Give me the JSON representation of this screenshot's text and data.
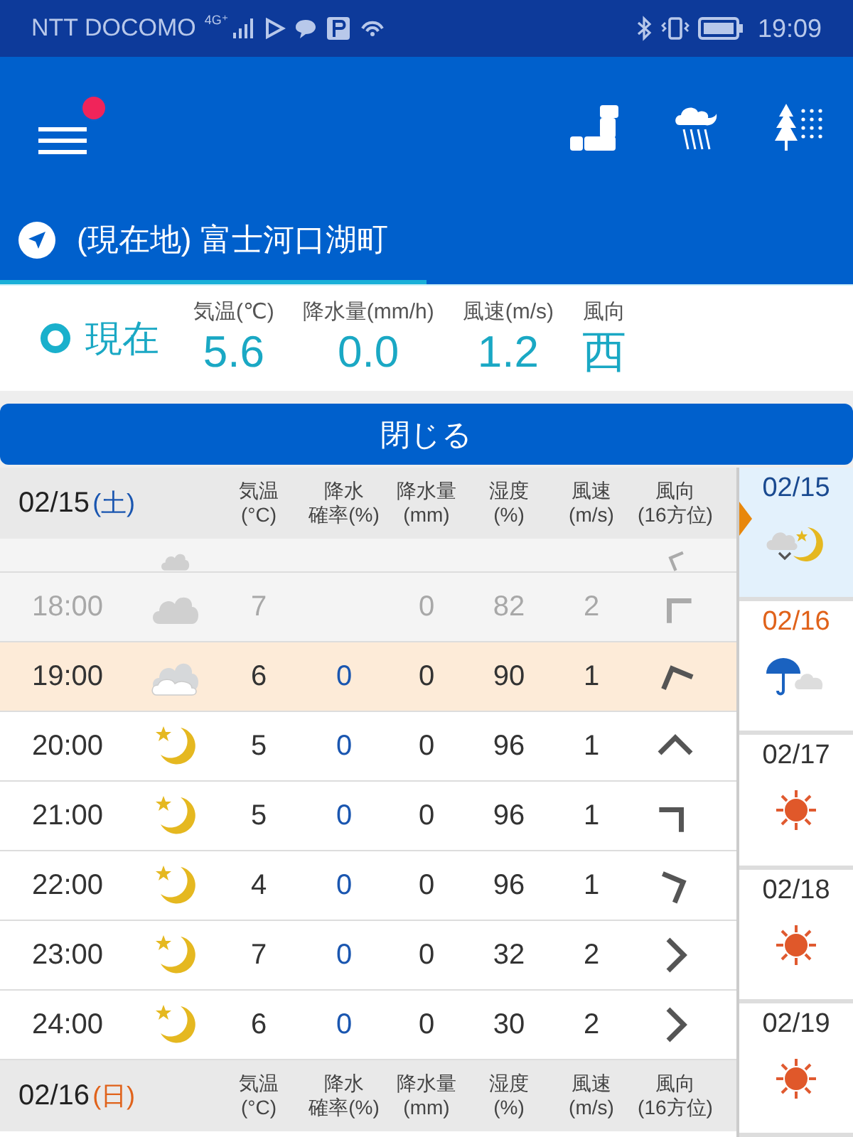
{
  "status_bar": {
    "carrier": "NTT DOCOMO",
    "network": "4G⁺",
    "time": "19:09"
  },
  "app_bar": {
    "menu_badge": true
  },
  "location_tab": {
    "label": "(現在地) 富士河口湖町",
    "selected": true
  },
  "current": {
    "label": "現在",
    "metrics": [
      {
        "label": "気温(℃)",
        "value": "5.6"
      },
      {
        "label": "降水量(mm/h)",
        "value": "0.0"
      },
      {
        "label": "風速(m/s)",
        "value": "1.2"
      },
      {
        "label": "風向",
        "value": "西"
      }
    ]
  },
  "close_button": "閉じる",
  "sections": [
    {
      "date": "02/15",
      "weekday": "(土)",
      "color": "#1a56b0",
      "columns": [
        [
          "気温",
          "(°C)"
        ],
        [
          "降水",
          "確率(%)"
        ],
        [
          "降水量",
          "(mm)"
        ],
        [
          "湿度",
          "(%)"
        ],
        [
          "風速",
          "(m/s)"
        ],
        [
          "風向",
          "(16方位)"
        ]
      ],
      "rows": [
        {
          "past": true,
          "highlighted": false,
          "kind": "cloud",
          "wind": {
            "kind": "wnw"
          }
        },
        {
          "time": "18:00",
          "past": true,
          "highlighted": false,
          "kind": "cloud",
          "temp": "7",
          "amount": "0",
          "humidity": "82",
          "speed": "2",
          "wind": {
            "kind": "nw"
          }
        },
        {
          "time": "19:00",
          "past": false,
          "highlighted": true,
          "kind": "cloudy",
          "temp": "6",
          "prob": "0",
          "amount": "0",
          "humidity": "90",
          "speed": "1",
          "wind": {
            "kind": "nnw"
          }
        },
        {
          "time": "20:00",
          "past": false,
          "highlighted": false,
          "kind": "moon",
          "temp": "5",
          "prob": "0",
          "amount": "0",
          "humidity": "96",
          "speed": "1",
          "wind": {
            "kind": "n"
          }
        },
        {
          "time": "21:00",
          "past": false,
          "highlighted": false,
          "kind": "moon",
          "temp": "5",
          "prob": "0",
          "amount": "0",
          "humidity": "96",
          "speed": "1",
          "wind": {
            "kind": "ne"
          }
        },
        {
          "time": "22:00",
          "past": false,
          "highlighted": false,
          "kind": "moon",
          "temp": "4",
          "prob": "0",
          "amount": "0",
          "humidity": "96",
          "speed": "1",
          "wind": {
            "kind": "ene"
          }
        },
        {
          "time": "23:00",
          "past": false,
          "highlighted": false,
          "kind": "moon",
          "temp": "7",
          "prob": "0",
          "amount": "0",
          "humidity": "32",
          "speed": "2",
          "wind": {
            "kind": "e"
          }
        },
        {
          "time": "24:00",
          "past": false,
          "highlighted": false,
          "kind": "moon",
          "temp": "6",
          "prob": "0",
          "amount": "0",
          "humidity": "30",
          "speed": "2",
          "wind": {
            "kind": "e"
          }
        }
      ]
    },
    {
      "date": "02/16",
      "weekday": "(日)",
      "color": "#e0621a",
      "columns": [
        [
          "気温",
          "(°C)"
        ],
        [
          "降水",
          "確率(%)"
        ],
        [
          "降水量",
          "(mm)"
        ],
        [
          "湿度",
          "(%)"
        ],
        [
          "風速",
          "(m/s)"
        ],
        [
          "風向",
          "(16方位)"
        ]
      ]
    }
  ],
  "days": [
    {
      "date": "02/15",
      "color": "#1a4a90",
      "kind": "cloud_moon",
      "selected": true
    },
    {
      "date": "02/16",
      "color": "#e0621a",
      "kind": "umbrella_cloud",
      "selected": false
    },
    {
      "date": "02/17",
      "color": "#333333",
      "kind": "sun",
      "selected": false
    },
    {
      "date": "02/18",
      "color": "#333333",
      "kind": "sun",
      "selected": false
    },
    {
      "date": "02/19",
      "color": "#333333",
      "kind": "sun",
      "selected": false
    }
  ]
}
